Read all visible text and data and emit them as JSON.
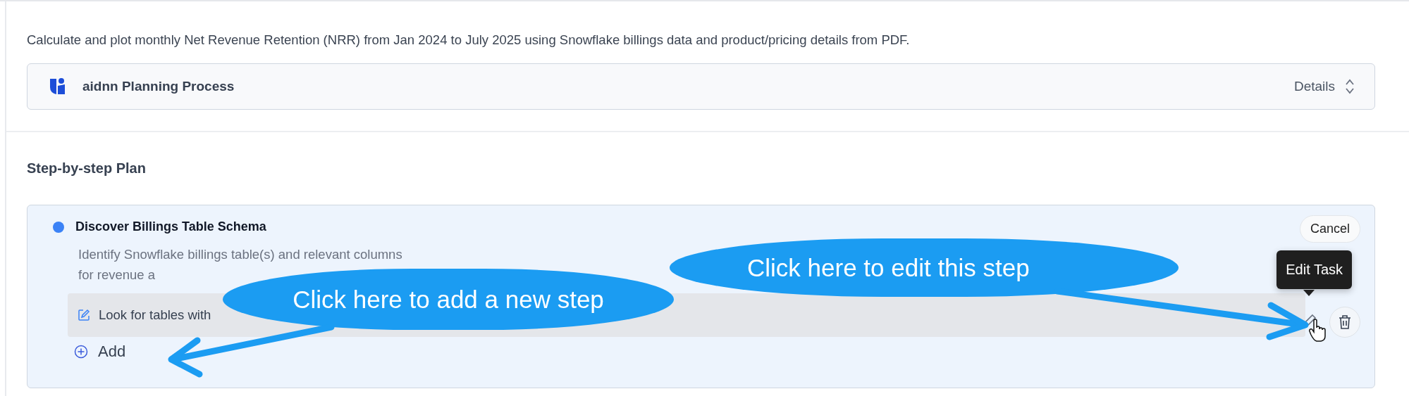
{
  "request": "Calculate and plot monthly Net Revenue Retention (NRR) from Jan 2024 to July 2025 using Snowflake billings data and product/pricing details from PDF.",
  "process": {
    "name": "aidnn Planning Process",
    "action": "Details"
  },
  "plan": {
    "heading": "Step-by-step Plan",
    "steps": [
      {
        "title": "Discover Billings Table Schema",
        "active": true,
        "description": "Identify Snowflake billings table(s) and relevant columns for revenue a",
        "tasks": [
          {
            "text": "Look for tables with",
            "hovered": true
          }
        ],
        "add_label": "Add",
        "cancel_label": "Cancel"
      }
    ]
  },
  "tooltip": "Edit Task",
  "callouts": [
    {
      "text": "Click here to add a new step",
      "kind": "add"
    },
    {
      "text": "Click here to edit this step",
      "kind": "edit"
    }
  ]
}
